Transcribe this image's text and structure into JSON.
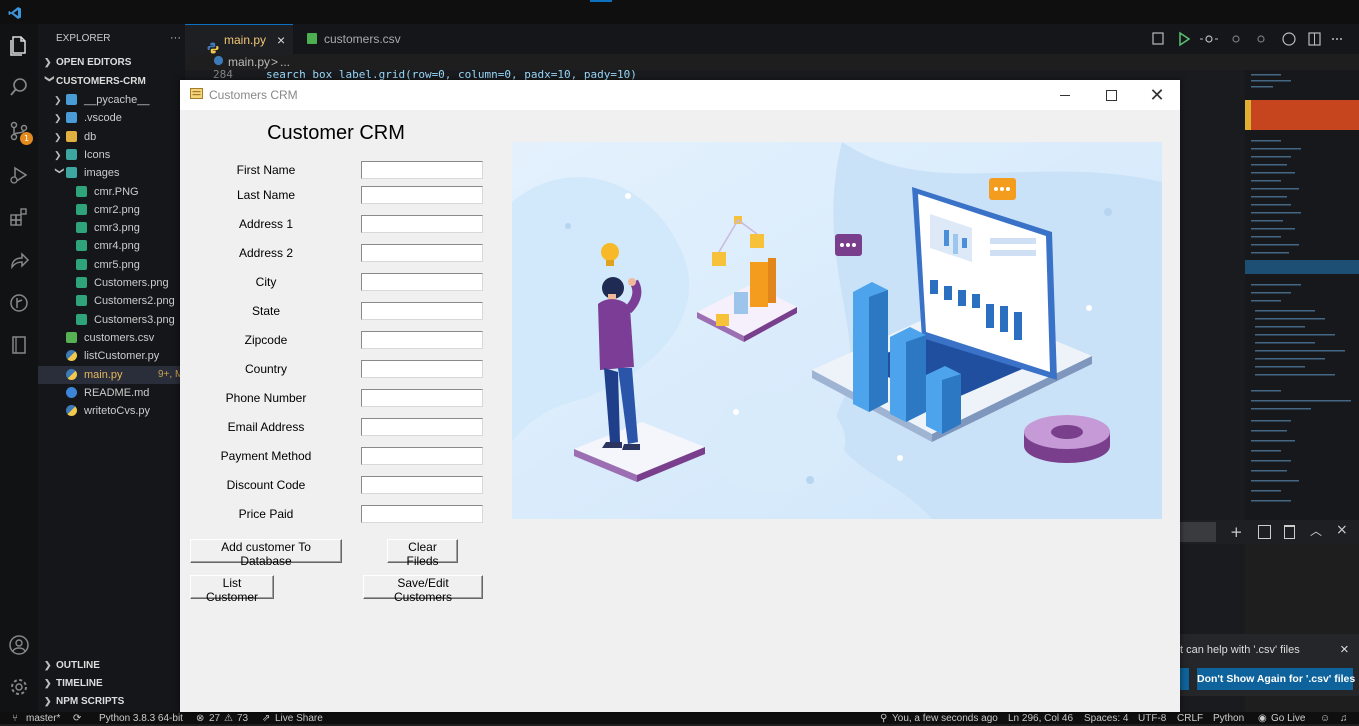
{
  "explorer": {
    "title": "EXPLORER",
    "more": "···",
    "open_editors": "OPEN EDITORS",
    "project": "CUSTOMERS-CRM",
    "items": [
      {
        "label": "__pycache__",
        "type": "folder",
        "color": "#4a9cd6"
      },
      {
        "label": ".vscode",
        "type": "folder",
        "color": "#4a9cd6"
      },
      {
        "label": "db",
        "type": "folder",
        "color": "#e0b040"
      },
      {
        "label": "Icons",
        "type": "folder",
        "color": "#3ea6a0"
      },
      {
        "label": "images",
        "type": "folder-open",
        "color": "#3ea6a0"
      },
      {
        "label": "cmr.PNG",
        "type": "image"
      },
      {
        "label": "cmr2.png",
        "type": "image"
      },
      {
        "label": "cmr3.png",
        "type": "image"
      },
      {
        "label": "cmr4.png",
        "type": "image"
      },
      {
        "label": "cmr5.png",
        "type": "image"
      },
      {
        "label": "Customers.png",
        "type": "image"
      },
      {
        "label": "Customers2.png",
        "type": "image"
      },
      {
        "label": "Customers3.png",
        "type": "image"
      },
      {
        "label": "customers.csv",
        "type": "csv"
      },
      {
        "label": "listCustomer.py",
        "type": "python"
      },
      {
        "label": "main.py",
        "type": "python",
        "badge": "9+, M"
      },
      {
        "label": "README.md",
        "type": "info"
      },
      {
        "label": "writetoCvs.py",
        "type": "python"
      }
    ],
    "outline": "OUTLINE",
    "timeline": "TIMELINE",
    "npm_scripts": "NPM SCRIPTS",
    "scm_badge": "1"
  },
  "tabs": [
    {
      "label": "main.py",
      "close": "×"
    },
    {
      "label": "customers.csv"
    }
  ],
  "breadcrumb": {
    "file": "main.py",
    "sep": ">",
    "rest": "..."
  },
  "code": {
    "line_number": "284",
    "text": "search_box_label.grid(row=0, column=0, padx=10, pady=10)"
  },
  "tk_window": {
    "title": "Customers CRM",
    "heading": "Customer CRM",
    "fields": [
      {
        "label": "First Name",
        "value": ""
      },
      {
        "label": "Last Name",
        "value": ""
      },
      {
        "label": "Address 1",
        "value": ""
      },
      {
        "label": "Address 2",
        "value": ""
      },
      {
        "label": "City",
        "value": ""
      },
      {
        "label": "State",
        "value": ""
      },
      {
        "label": "Zipcode",
        "value": ""
      },
      {
        "label": "Country",
        "value": ""
      },
      {
        "label": "Phone Number",
        "value": ""
      },
      {
        "label": "Email Address",
        "value": ""
      },
      {
        "label": "Payment Method",
        "value": ""
      },
      {
        "label": "Discount Code",
        "value": ""
      },
      {
        "label": "Price Paid",
        "value": ""
      }
    ],
    "buttons": {
      "add": "Add customer To Database",
      "clear": "Clear Fileds",
      "list": "List Customer",
      "save_edit": "Save/Edit Customers"
    }
  },
  "notification": {
    "message": "t can help with '.csv' files",
    "dont_show": "Don't Show Again for '.csv' files",
    "close": "×"
  },
  "status": {
    "branch": "master*",
    "python": "Python 3.8.3 64-bit",
    "errors": "27",
    "warnings": "73",
    "live_share": "Live Share",
    "blame": "You, a few seconds ago",
    "position": "Ln 296, Col 46",
    "spaces": "Spaces: 4",
    "encoding": "UTF-8",
    "eol": "CRLF",
    "language": "Python",
    "go_live": "Go Live"
  },
  "colors": {
    "accent": "#0e639c",
    "tk_bg": "#f0f0f0",
    "illustration_bg": "#dbeefc",
    "purple": "#7a3f8c",
    "orange": "#f5a623",
    "blue": "#3d8fd6"
  }
}
